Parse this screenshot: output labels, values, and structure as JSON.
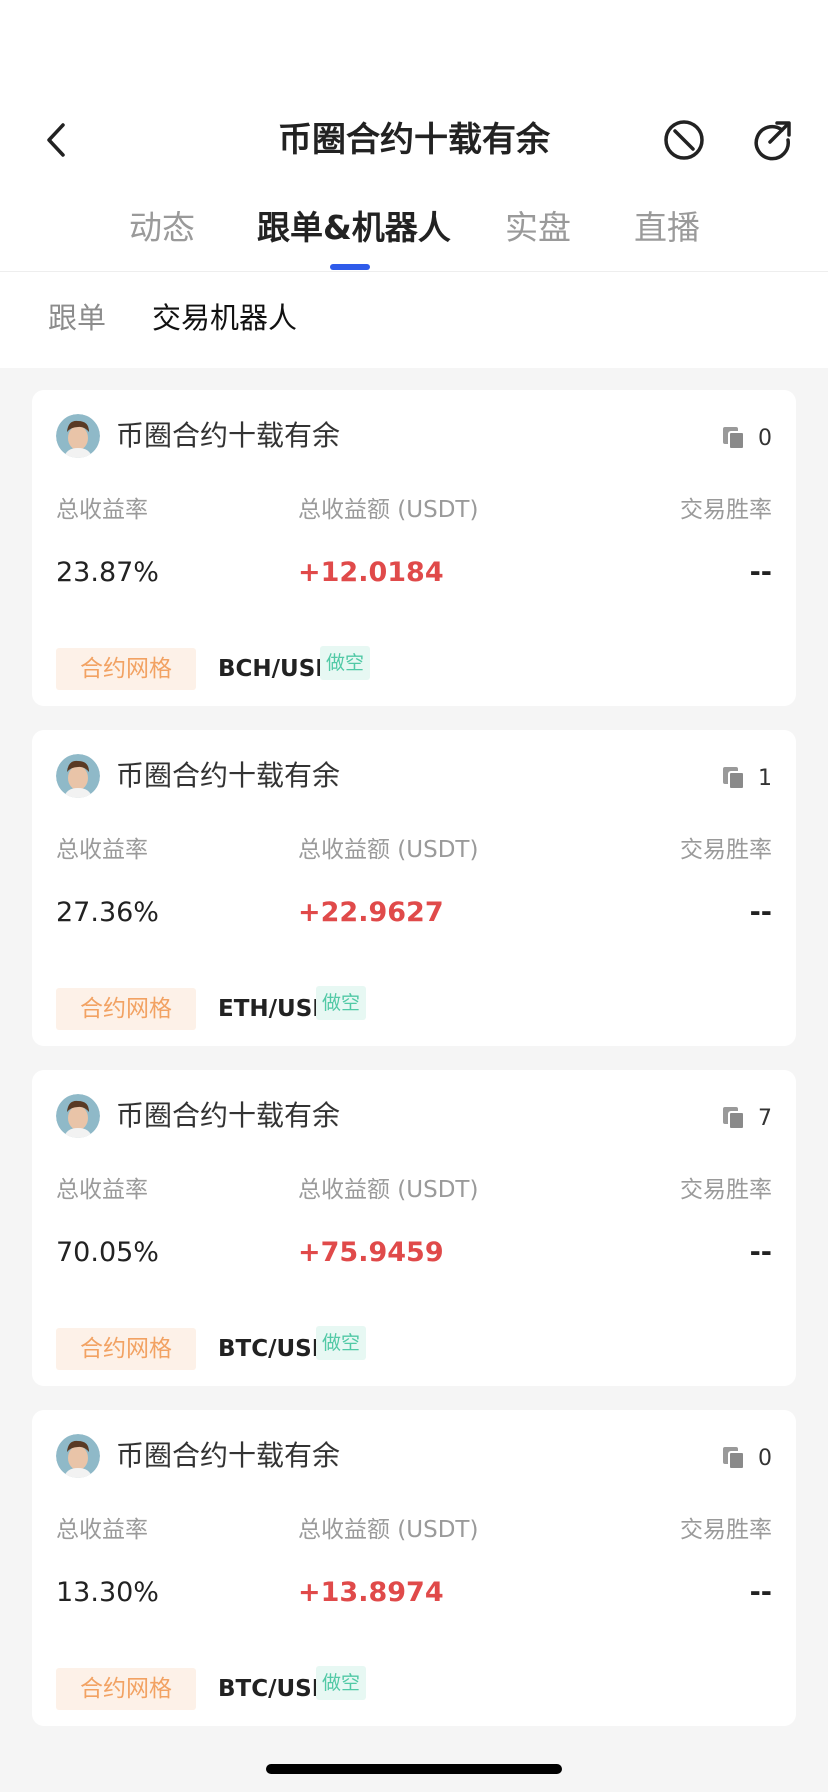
{
  "header": {
    "title": "币圈合约十载有余",
    "icons": {
      "back": "chevron-left-icon",
      "block": "block-icon",
      "share": "share-icon"
    }
  },
  "tabs": [
    {
      "label": "动态",
      "active": false
    },
    {
      "label": "跟单&机器人",
      "active": true
    },
    {
      "label": "实盘",
      "active": false
    },
    {
      "label": "直播",
      "active": false
    }
  ],
  "subtabs": [
    {
      "label": "跟单",
      "active": false
    },
    {
      "label": "交易机器人",
      "active": true
    }
  ],
  "labels": {
    "total_return_rate": "总收益率",
    "total_return_amount": "总收益额 (USDT)",
    "win_rate": "交易胜率"
  },
  "cards": [
    {
      "name": "币圈合约十载有余",
      "copy_count": "0",
      "return_rate": "23.87%",
      "return_amount": "+12.0184",
      "win_rate": "--",
      "type_tag": "合约网格",
      "pair": "BCH/USDT",
      "direction": "做空"
    },
    {
      "name": "币圈合约十载有余",
      "copy_count": "1",
      "return_rate": "27.36%",
      "return_amount": "+22.9627",
      "win_rate": "--",
      "type_tag": "合约网格",
      "pair": "ETH/USDT",
      "direction": "做空"
    },
    {
      "name": "币圈合约十载有余",
      "copy_count": "7",
      "return_rate": "70.05%",
      "return_amount": "+75.9459",
      "win_rate": "--",
      "type_tag": "合约网格",
      "pair": "BTC/USDT",
      "direction": "做空"
    },
    {
      "name": "币圈合约十载有余",
      "copy_count": "0",
      "return_rate": "13.30%",
      "return_amount": "+13.8974",
      "win_rate": "--",
      "type_tag": "合约网格",
      "pair": "BTC/USDT",
      "direction": "做空"
    }
  ],
  "colors": {
    "accent": "#2f5bea",
    "profit": "#e04a4a",
    "grid_tag_bg": "#fdf1e8",
    "grid_tag_text": "#f2a263",
    "short_tag_bg": "#e7f8f3",
    "short_tag_text": "#52c9a6"
  }
}
